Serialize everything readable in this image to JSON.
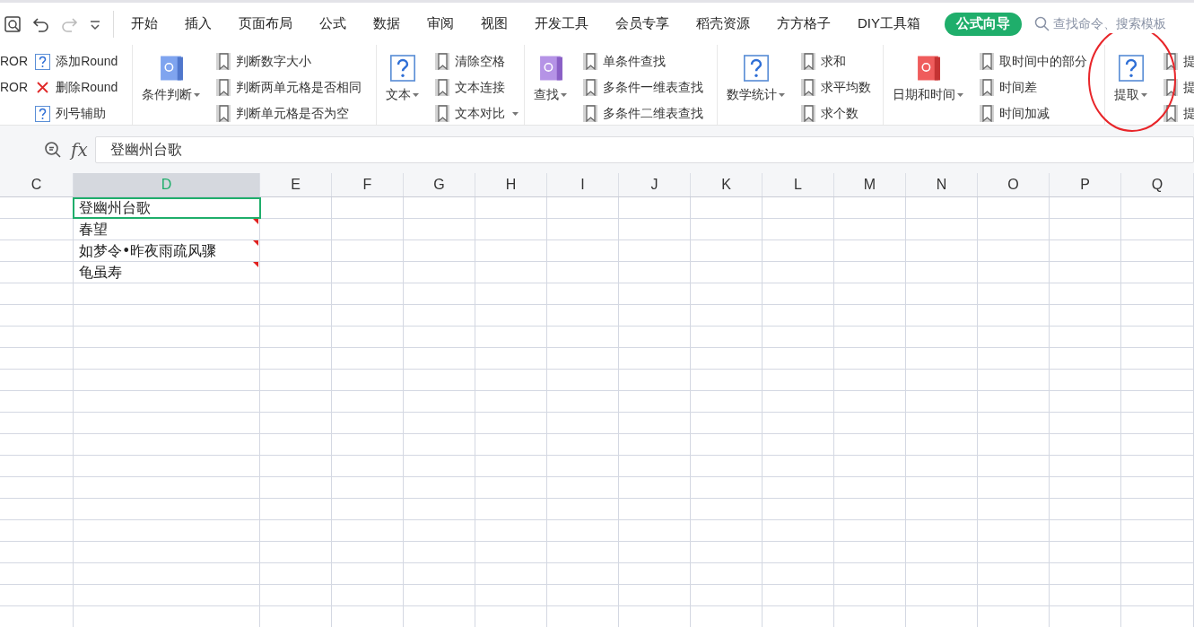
{
  "quick_access": {
    "redo_disabled": true
  },
  "tabs": [
    {
      "label": "开始",
      "selected": false
    },
    {
      "label": "插入",
      "selected": false
    },
    {
      "label": "页面布局",
      "selected": false
    },
    {
      "label": "公式",
      "selected": false
    },
    {
      "label": "数据",
      "selected": false
    },
    {
      "label": "审阅",
      "selected": false
    },
    {
      "label": "视图",
      "selected": false
    },
    {
      "label": "开发工具",
      "selected": false
    },
    {
      "label": "会员专享",
      "selected": false
    },
    {
      "label": "稻壳资源",
      "selected": false
    },
    {
      "label": "方方格子",
      "selected": false
    },
    {
      "label": "DIY工具箱",
      "selected": false
    },
    {
      "label": "公式向导",
      "selected": true
    }
  ],
  "search": {
    "placeholder": "查找命令、搜索模板"
  },
  "ribbon": {
    "groups": [
      {
        "cut_labels": [
          "ROR",
          "ROR"
        ],
        "items": [
          {
            "kind": "help",
            "label": "添加Round",
            "has_menu": false
          },
          {
            "kind": "delete",
            "label": "删除Round",
            "has_menu": false
          },
          {
            "kind": "help",
            "label": "列号辅助",
            "has_menu": false
          }
        ]
      },
      {
        "big": {
          "label": "条件判断"
        },
        "items": [
          {
            "kind": "bookmark",
            "label": "判断数字大小",
            "has_menu": false
          },
          {
            "kind": "bookmark",
            "label": "判断两单元格是否相同",
            "has_menu": false
          },
          {
            "kind": "bookmark",
            "label": "判断单元格是否为空",
            "has_menu": false
          }
        ]
      },
      {
        "big": {
          "label": "文本"
        },
        "items": [
          {
            "kind": "bookmark",
            "label": "清除空格",
            "has_menu": false
          },
          {
            "kind": "bookmark",
            "label": "文本连接",
            "has_menu": false
          },
          {
            "kind": "bookmark",
            "label": "文本对比",
            "has_menu": true
          }
        ]
      },
      {
        "big": {
          "label": "查找"
        },
        "items": [
          {
            "kind": "bookmark",
            "label": "单条件查找",
            "has_menu": false
          },
          {
            "kind": "bookmark",
            "label": "多条件一维表查找",
            "has_menu": false
          },
          {
            "kind": "bookmark",
            "label": "多条件二维表查找",
            "has_menu": false
          }
        ]
      },
      {
        "big": {
          "label": "数学统计"
        },
        "items": [
          {
            "kind": "bookmark",
            "label": "求和",
            "has_menu": false
          },
          {
            "kind": "bookmark",
            "label": "求平均数",
            "has_menu": false
          },
          {
            "kind": "bookmark",
            "label": "求个数",
            "has_menu": false
          }
        ]
      },
      {
        "big": {
          "label": "日期和时间"
        },
        "items": [
          {
            "kind": "bookmark",
            "label": "取时间中的部分",
            "has_menu": false
          },
          {
            "kind": "bookmark",
            "label": "时间差",
            "has_menu": false
          },
          {
            "kind": "bookmark",
            "label": "时间加减",
            "has_menu": false
          }
        ]
      },
      {
        "big": {
          "label": "提取"
        },
        "items": [
          {
            "kind": "bookmark",
            "label": "提"
          },
          {
            "kind": "bookmark",
            "label": "提"
          },
          {
            "kind": "bookmark",
            "label": "提"
          }
        ]
      }
    ]
  },
  "formula_bar": {
    "fx_label": "fx",
    "value": "登幽州台歌"
  },
  "sheet": {
    "columns": [
      {
        "label": "C",
        "selected": false
      },
      {
        "label": "D",
        "selected": true
      },
      {
        "label": "E",
        "selected": false
      },
      {
        "label": "F",
        "selected": false
      },
      {
        "label": "G",
        "selected": false
      },
      {
        "label": "H",
        "selected": false
      },
      {
        "label": "I",
        "selected": false
      },
      {
        "label": "J",
        "selected": false
      },
      {
        "label": "K",
        "selected": false
      },
      {
        "label": "L",
        "selected": false
      },
      {
        "label": "M",
        "selected": false
      },
      {
        "label": "N",
        "selected": false
      },
      {
        "label": "O",
        "selected": false
      },
      {
        "label": "P",
        "selected": false
      },
      {
        "label": "Q",
        "selected": false
      }
    ],
    "cells": [
      {
        "text": "登幽州台歌",
        "selected": true,
        "comment": false
      },
      {
        "text": "春望",
        "selected": false,
        "comment": true
      },
      {
        "text": "如梦令•昨夜雨疏风骤",
        "selected": false,
        "comment": true
      },
      {
        "text": "龟虽寿",
        "selected": false,
        "comment": true
      }
    ]
  }
}
